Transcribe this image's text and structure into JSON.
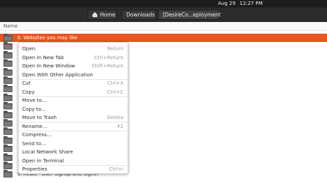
{
  "topbar": {
    "date": "Aug 29",
    "time": "12:27 PM"
  },
  "pathbar": {
    "home": "Home",
    "downloads": "Downloads",
    "current": "[DesireCo...eployment"
  },
  "list": {
    "column_name": "Name",
    "items": [
      {
        "label": "0. Websites you may like",
        "selected": true
      },
      {
        "label": ""
      },
      {
        "label": ""
      },
      {
        "label": ""
      },
      {
        "label": ""
      },
      {
        "label": ""
      },
      {
        "label": ""
      },
      {
        "label": ""
      },
      {
        "label": ""
      },
      {
        "label": ""
      },
      {
        "label": ""
      },
      {
        "label": ""
      },
      {
        "label": ""
      },
      {
        "label": ""
      },
      {
        "label": ""
      },
      {
        "label": ""
      },
      {
        "label": "9. React - User Signup and Signin"
      }
    ]
  },
  "context_menu": {
    "items": [
      {
        "label": "Open",
        "shortcut": "Return"
      },
      {
        "label": "Open In New Tab",
        "shortcut": "Ctrl+Return"
      },
      {
        "label": "Open In New Window",
        "shortcut": "Shift+Return"
      },
      {
        "label": "Open With Other Application",
        "shortcut": ""
      },
      {
        "label": "Cut",
        "shortcut": "Ctrl+X"
      },
      {
        "label": "Copy",
        "shortcut": "Ctrl+C"
      },
      {
        "label": "Move to…",
        "shortcut": ""
      },
      {
        "label": "Copy to…",
        "shortcut": ""
      },
      {
        "label": "Move to Trash",
        "shortcut": "Delete"
      },
      {
        "label": "Rename…",
        "shortcut": "F2"
      },
      {
        "label": "Compress…",
        "shortcut": ""
      },
      {
        "label": "Send to…",
        "shortcut": ""
      },
      {
        "label": "Local Network Share",
        "shortcut": ""
      },
      {
        "label": "Open in Terminal",
        "shortcut": ""
      },
      {
        "label": "Properties",
        "shortcut": "Ctrl+I"
      }
    ]
  }
}
